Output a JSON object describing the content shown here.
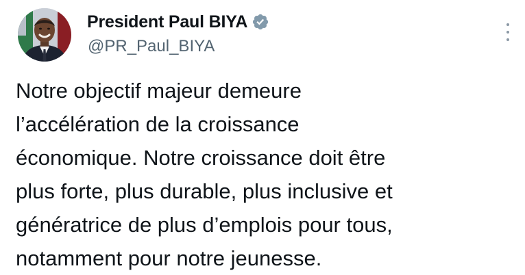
{
  "tweet": {
    "author": {
      "display_name": "President Paul BIYA",
      "handle": "@PR_Paul_BIYA",
      "verified": true,
      "verified_badge_color": "#829aab",
      "avatar": "profile-photo"
    },
    "menu_icon": "more-vertical-icon",
    "text_lines": [
      "Notre objectif majeur demeure",
      "l’accélération de la croissance",
      "économique. Notre croissance doit être",
      "plus forte, plus durable, plus inclusive et",
      "génératrice de plus d’emplois pour tous,",
      "notamment pour notre jeunesse."
    ]
  },
  "colors": {
    "text_primary": "#0f1419",
    "text_secondary": "#536471",
    "background": "#ffffff"
  }
}
